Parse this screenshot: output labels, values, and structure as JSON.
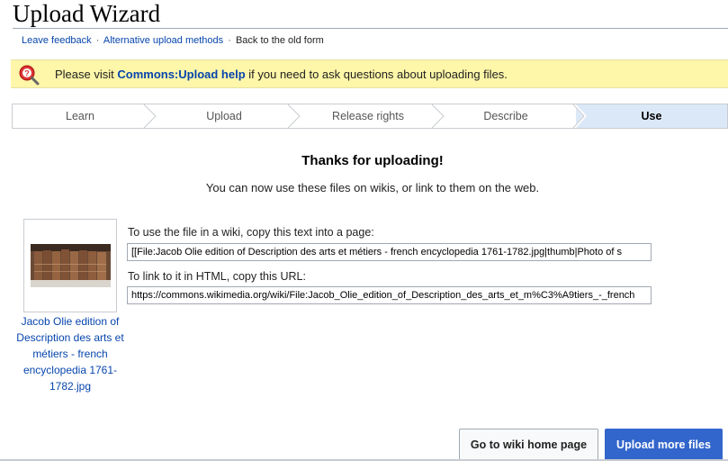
{
  "page": {
    "title": "Upload Wizard"
  },
  "links": {
    "feedback": "Leave feedback",
    "alternative": "Alternative upload methods",
    "old_form": "Back to the old form",
    "separator": "·"
  },
  "notice": {
    "before": "Please visit ",
    "link": "Commons:Upload help",
    "after": " if you need to ask questions about uploading files.",
    "icon": "help-magnifier-icon"
  },
  "steps": {
    "items": [
      "Learn",
      "Upload",
      "Release rights",
      "Describe",
      "Use"
    ],
    "active": "Use"
  },
  "result": {
    "heading": "Thanks for uploading!",
    "subtext": "You can now use these files on wikis, or link to them on the web."
  },
  "file": {
    "caption": "Jacob Olie edition of Description des arts et métiers - french encyclopedia 1761-1782.jpg",
    "wiki_label": "To use the file in a wiki, copy this text into a page:",
    "wiki_text": "[[File:Jacob Olie edition of Description des arts et métiers - french encyclopedia 1761-1782.jpg|thumb|Photo of s",
    "url_label": "To link to it in HTML, copy this URL:",
    "url_text": "https://commons.wikimedia.org/wiki/File:Jacob_Olie_edition_of_Description_des_arts_et_m%C3%A9tiers_-_french"
  },
  "buttons": {
    "home": "Go to wiki home page",
    "more": "Upload more files"
  },
  "colors": {
    "link": "#0645ad",
    "notice_bg": "#fef6a8",
    "active_step_bg": "#dbe8f7",
    "primary_button": "#3366cc"
  }
}
